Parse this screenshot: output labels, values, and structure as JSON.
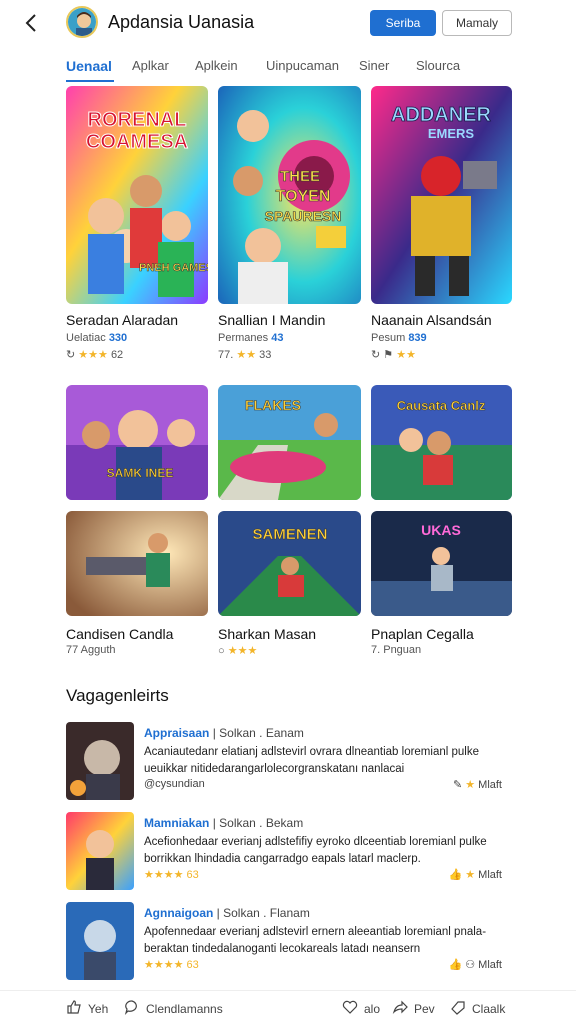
{
  "header": {
    "title": "Apdansia Uanasia",
    "primary_btn": "Seriba",
    "secondary_btn": "Mamaly"
  },
  "tabs": [
    "Uenaal",
    "Aplkar",
    "Aplkein",
    "Uinpucaman",
    "Siner",
    "Slourca"
  ],
  "cards": [
    {
      "title": "Seradan Alaradan",
      "sub_text": "Uelatiac",
      "badge": "330",
      "stars": "★★★",
      "count": "62"
    },
    {
      "title": "Snallian I Mandin",
      "sub_text": "Permanes",
      "badge": "43",
      "stars": "",
      "count": ""
    },
    {
      "title": "Naanain Alsandsán",
      "sub_text": "Pesum",
      "badge": "839",
      "stars": "",
      "count": ""
    },
    {
      "title": "Candisen Candla",
      "sub_text": "77 Agguth",
      "badge": "",
      "stars": "",
      "count": ""
    },
    {
      "title": "Sharkan Masan",
      "sub_text": "",
      "badge": "",
      "stars": "★★★",
      "count": ""
    },
    {
      "title": "Pnaplan Cegalla",
      "sub_text": "7. Pnguan",
      "badge": "",
      "stars": "",
      "count": ""
    }
  ],
  "row2_meta": {
    "c1": "77. ",
    "c1_stars": "★★",
    "c1_count": "33",
    "c3_stars": "★★"
  },
  "thumb_texts": {
    "t1a": "RORENAL",
    "t1b": "COAMESA",
    "t1c": "PNEH GAMES",
    "t2a": "THEE",
    "t2b": "TOYEN",
    "t2c": "SPAURESN",
    "t3a": "ADDANER",
    "t3b": "EMERS",
    "t4": "SAMK INEE",
    "t5": "FLAKES",
    "t6": "Causata Canlz",
    "t8": "SAMENEN",
    "t9": "UKAS"
  },
  "section": {
    "title": "Vagagenleirts"
  },
  "reviews": [
    {
      "name": "Appraisaan",
      "head_rest": " | Solkan . Eanam",
      "text": "Acaniautedanr elatianj adlstevirl ovrara dlneantiab loremianl pulke ueuikkar nitidedarangarlolecorgranskatanı nanlacai",
      "meta": "@cysundian",
      "action": "Mlaft"
    },
    {
      "name": "Mamniakan",
      "head_rest": " | Solkan . Bekam",
      "text": "Acefionhedaar everianj adlstefifiy eyroko dlceentiab loremianl pulke borrikkan lhindadia cangarradgo eapals latarl maclerp.",
      "meta": "★★★★ 63",
      "action": "Mlaft"
    },
    {
      "name": "Agnnaigoan",
      "head_rest": " | Solkan . Flanam",
      "text": "Apofennedaar everianj adlstevirl ernern aleeantiab loremianl pnala-beraktan tindedalanoganti lecokareals latadı neansern",
      "meta": "★★★★ 63",
      "action": "Mlaft"
    }
  ],
  "bottom_nav": [
    "Yeh",
    "Clendlamanns",
    "alo",
    "Pev",
    "Claalk"
  ]
}
